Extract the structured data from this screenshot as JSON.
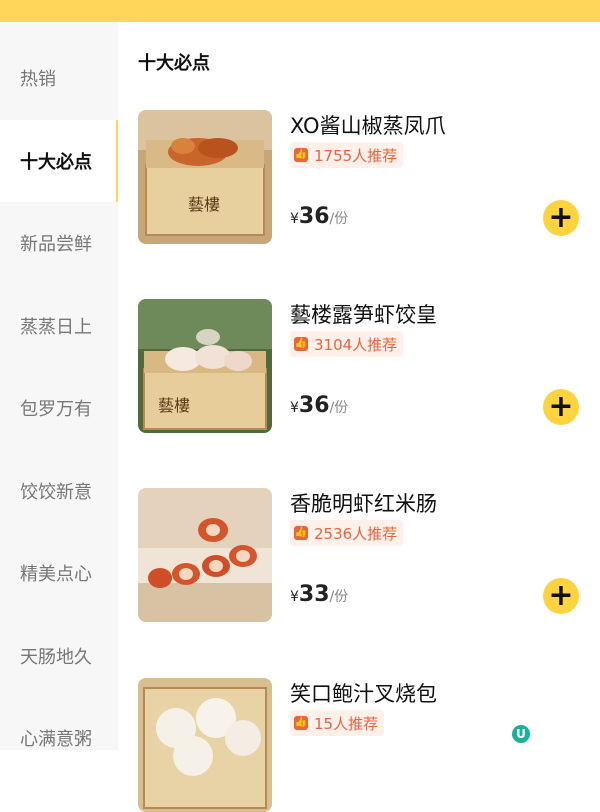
{
  "sidebar": {
    "categories": [
      {
        "label": "热销"
      },
      {
        "label": "十大必点"
      },
      {
        "label": "新品尝鲜"
      },
      {
        "label": "蒸蒸日上"
      },
      {
        "label": "包罗万有"
      },
      {
        "label": "饺饺新意"
      },
      {
        "label": "精美点心"
      },
      {
        "label": "天肠地久"
      },
      {
        "label": "心满意粥"
      }
    ],
    "active_index": 1
  },
  "main": {
    "section_title": "十大必点",
    "items": [
      {
        "name": "XO酱山椒蒸凤爪",
        "recommend": "1755人推荐",
        "currency": "¥",
        "price": "36",
        "unit": "/份"
      },
      {
        "name": "藝楼露笋虾饺皇",
        "recommend": "3104人推荐",
        "currency": "¥",
        "price": "36",
        "unit": "/份"
      },
      {
        "name": "香脆明虾红米肠",
        "recommend": "2536人推荐",
        "currency": "¥",
        "price": "33",
        "unit": "/份"
      },
      {
        "name": "笑口鲍汁叉烧包",
        "recommend": "15人推荐"
      }
    ]
  },
  "icons": {
    "add": "plus-icon",
    "recommend": "thumbs-up-icon",
    "brand": "brand-logo-icon"
  },
  "colors": {
    "accent": "#FFD65A",
    "button": "#FFD23F",
    "badge_text": "#E8643F",
    "badge_bg": "#FFF0EA",
    "sidebar_bg": "#F7F7F7"
  }
}
